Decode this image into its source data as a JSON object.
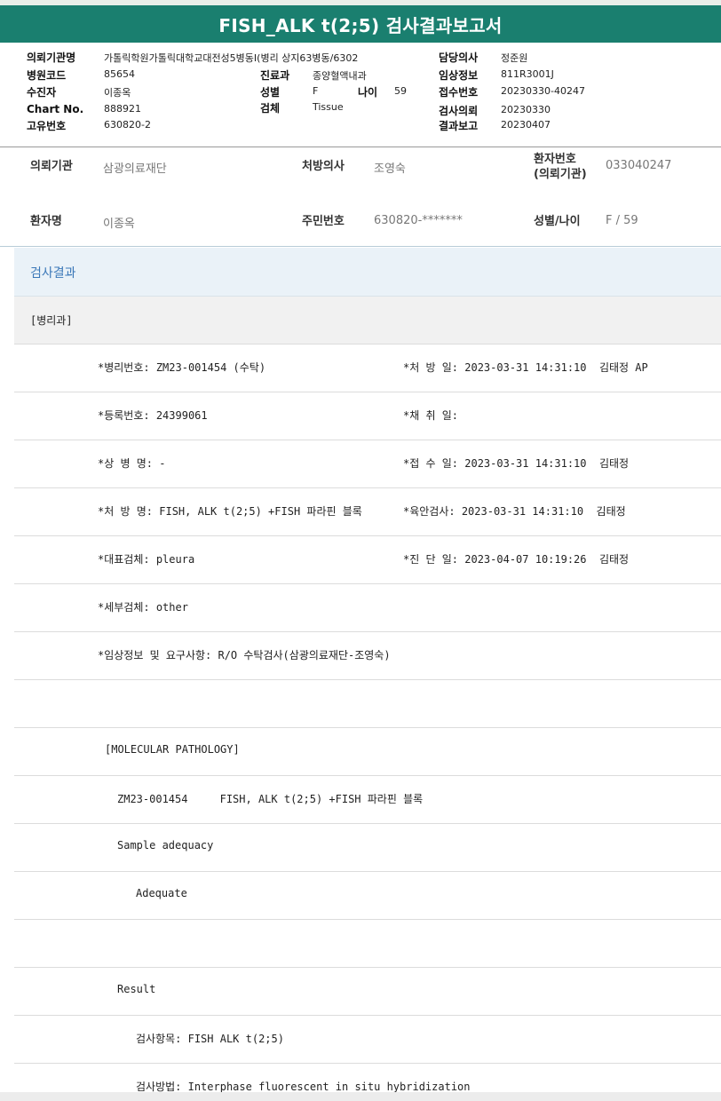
{
  "title": "FISH_ALK t(2;5) 검사결과보고서",
  "header": {
    "inst_label": "의뢰기관명",
    "inst_value": "가톨릭학원가톨릭대학교대전성5병동I(병리 상지63병동/6302",
    "doctor_label": "담당의사",
    "doctor_value": "정준원",
    "hosp_code_label": "병원코드",
    "hosp_code_value": "85654",
    "dept_label": "진료과",
    "dept_value": "종양혈액내과",
    "clinical_label": "임상정보",
    "clinical_value": "811R3001J",
    "patient_label": "수진자",
    "patient_value": "이종옥",
    "sex_label": "성별",
    "sex_value": "F",
    "age_label": "나이",
    "age_value": "59",
    "accession_label": "접수번호",
    "accession_value": "20230330-40247",
    "chart_label": "Chart No.",
    "chart_value": "888921",
    "specimen_label": "검체",
    "specimen_value": "Tissue",
    "request_label": "검사의뢰",
    "request_value": "20230330",
    "unique_label": "고유번호",
    "unique_value": "630820-2",
    "report_label": "결과보고",
    "report_value": "20230407"
  },
  "patient": {
    "requester_label": "의뢰기관",
    "requester_value": "삼광의료재단",
    "prescriber_label": "처방의사",
    "prescriber_value": "조영숙",
    "patient_no_label_1": "환자번호",
    "patient_no_label_2": "(의뢰기관)",
    "patient_no_value": "033040247",
    "name_label": "환자명",
    "name_value": "이종옥",
    "rrn_label": "주민번호",
    "rrn_value": "630820-*******",
    "sexage_label": "성별/나이",
    "sexage_value": "F / 59"
  },
  "results": {
    "section_title": "검사결과",
    "department": "[병리과]",
    "pathology_no": "*병리번호: ZM23-001454 (수탁)",
    "prescription_date": "*처 방 일: 2023-03-31 14:31:10  김태정 AP",
    "registration_no": "*등록번호: 24399061",
    "collection_date": "*채 취 일:",
    "disease_name": "*상 병 명: -",
    "receipt_date": "*접 수 일: 2023-03-31 14:31:10  김태정",
    "prescription_name": "*처 방 명: FISH, ALK t(2;5) +FISH 파라핀 블록",
    "gross_exam": "*육안검사: 2023-03-31 14:31:10  김태정",
    "main_specimen": "*대표검체: pleura",
    "diagnosis_date": "*진 단 일: 2023-04-07 10:19:26  김태정",
    "sub_specimen": "*세부검체: other",
    "clinical_info": "*임상정보 및 요구사항: R/O 수탁검사(삼광의료재단-조영숙)",
    "molecular_header": "[MOLECULAR PATHOLOGY]",
    "case_line": "ZM23-001454     FISH, ALK t(2;5) +FISH 파라핀 블록",
    "sample_adequacy": "Sample adequacy",
    "adequate": "Adequate",
    "result_label": "Result",
    "test_item": "검사항목: FISH ALK t(2;5)",
    "test_method": "검사방법: Interphase fluorescent in situ hybridization"
  }
}
